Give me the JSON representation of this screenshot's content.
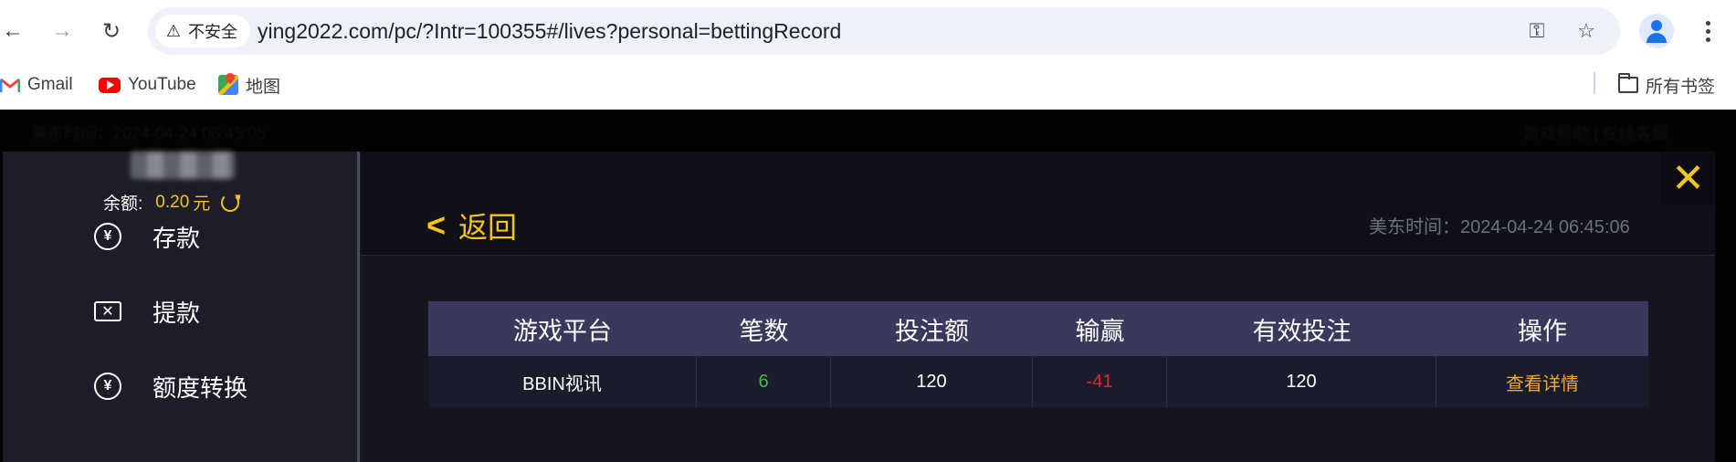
{
  "browser": {
    "security_label": "不安全",
    "url": "ying2022.com/pc/?Intr=100355#/lives?personal=bettingRecord",
    "bookmarks": [
      {
        "label": "Gmail",
        "icon": "gmail-icon"
      },
      {
        "label": "YouTube",
        "icon": "youtube-icon"
      },
      {
        "label": "地图",
        "icon": "maps-icon"
      }
    ],
    "all_bookmarks_label": "所有书签"
  },
  "background": {
    "left_text": "美东时间：2024-04-24 06:45:05",
    "right_text": "游戏帮助 | 在线客服"
  },
  "sidebar": {
    "balance_label": "余额:",
    "balance_amount": "0.20",
    "balance_unit": "元",
    "items": [
      {
        "label": "存款",
        "icon": "yuan-icon"
      },
      {
        "label": "提款",
        "icon": "ticket-icon"
      },
      {
        "label": "额度转换",
        "icon": "exchange-icon"
      }
    ]
  },
  "main": {
    "back_label": "返回",
    "time_label": "美东时间：2024-04-24 06:45:06",
    "close_symbol": "✕"
  },
  "table": {
    "headers": [
      "游戏平台",
      "笔数",
      "投注额",
      "输赢",
      "有效投注",
      "操作"
    ],
    "rows": [
      {
        "platform": "BBIN视讯",
        "count": "6",
        "bet": "120",
        "winloss": "-41",
        "valid_bet": "120",
        "action": "查看详情"
      }
    ]
  },
  "colors": {
    "accent": "#f5c518",
    "count_green": "#3fbf3f",
    "loss_red": "#e8262a",
    "action_orange": "#f0a830"
  }
}
